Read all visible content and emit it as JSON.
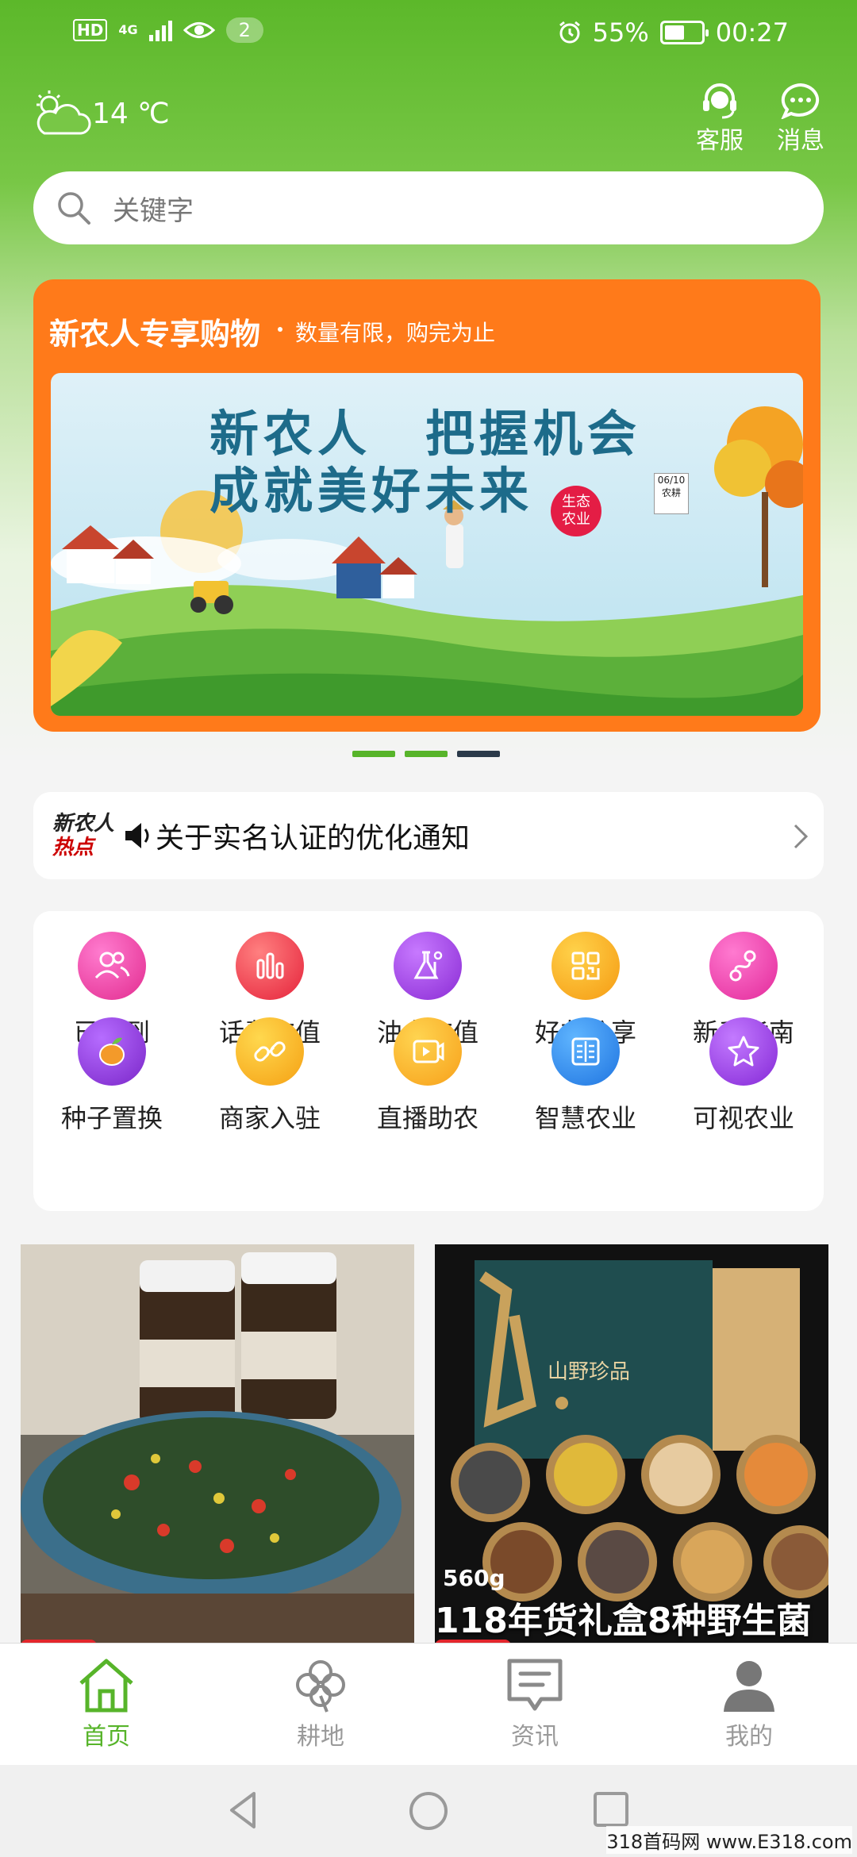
{
  "status_bar": {
    "hd": "HD",
    "network": "4G",
    "notification_count": "2",
    "battery": "55%",
    "battery_level": 0.55,
    "time": "00:27"
  },
  "weather": {
    "temperature": "14 ℃",
    "icon": "cloud-icon"
  },
  "header_actions": {
    "service_label": "客服",
    "message_label": "消息"
  },
  "search": {
    "placeholder": "关键字"
  },
  "promo": {
    "title": "新农人专享购物",
    "subtitle": "数量有限，购完为止",
    "headline_1": "新农人　把握机会",
    "headline_2": "成就美好未来",
    "badge_1": "生态",
    "badge_2": "农业",
    "calendar_date": "06/10",
    "calendar_note": "农耕"
  },
  "carousel": {
    "count": 3,
    "active_index": 2
  },
  "notice": {
    "logo_line_1": "新农人",
    "logo_line_2": "热点",
    "text": "关于实名认证的优化通知"
  },
  "grid": {
    "items": [
      {
        "label": "已签到",
        "icon": "user-group-icon",
        "color": "#ec3aa0"
      },
      {
        "label": "话费充值",
        "icon": "bar-chart-icon",
        "color": "#ef3a4c"
      },
      {
        "label": "油卡充值",
        "icon": "flask-icon",
        "color": "#9d3be0"
      },
      {
        "label": "好友分享",
        "icon": "qr-grid-icon",
        "color": "#f7a21b"
      },
      {
        "label": "新手指南",
        "icon": "route-icon",
        "color": "#ee3aa8"
      },
      {
        "label": "种子置换",
        "icon": "fruit-icon",
        "color": "#8e3bd6"
      },
      {
        "label": "商家入驻",
        "icon": "link-icon",
        "color": "#f7ac1c"
      },
      {
        "label": "直播助农",
        "icon": "video-icon",
        "color": "#f9a41c"
      },
      {
        "label": "智慧农业",
        "icon": "book-icon",
        "color": "#2c88f0"
      },
      {
        "label": "可视农业",
        "icon": "star-icon",
        "color": "#9a3be0"
      }
    ]
  },
  "products": [
    {
      "name": "product-pickles"
    },
    {
      "name": "product-mushroom-gift-box",
      "box_title": "山野珍品",
      "weight": "560g",
      "caption": "118年货礼盒8种野生菌"
    }
  ],
  "bottom_nav": {
    "items": [
      {
        "label": "首页",
        "icon": "home-icon",
        "active": true
      },
      {
        "label": "耕地",
        "icon": "clover-icon",
        "active": false
      },
      {
        "label": "资讯",
        "icon": "news-icon",
        "active": false
      },
      {
        "label": "我的",
        "icon": "profile-icon",
        "active": false
      }
    ]
  },
  "watermark": "318首码网 www.E318.com",
  "colors": {
    "brand_green": "#57b42a",
    "promo_orange": "#ff7a1a",
    "hot_red": "#cc0000"
  }
}
